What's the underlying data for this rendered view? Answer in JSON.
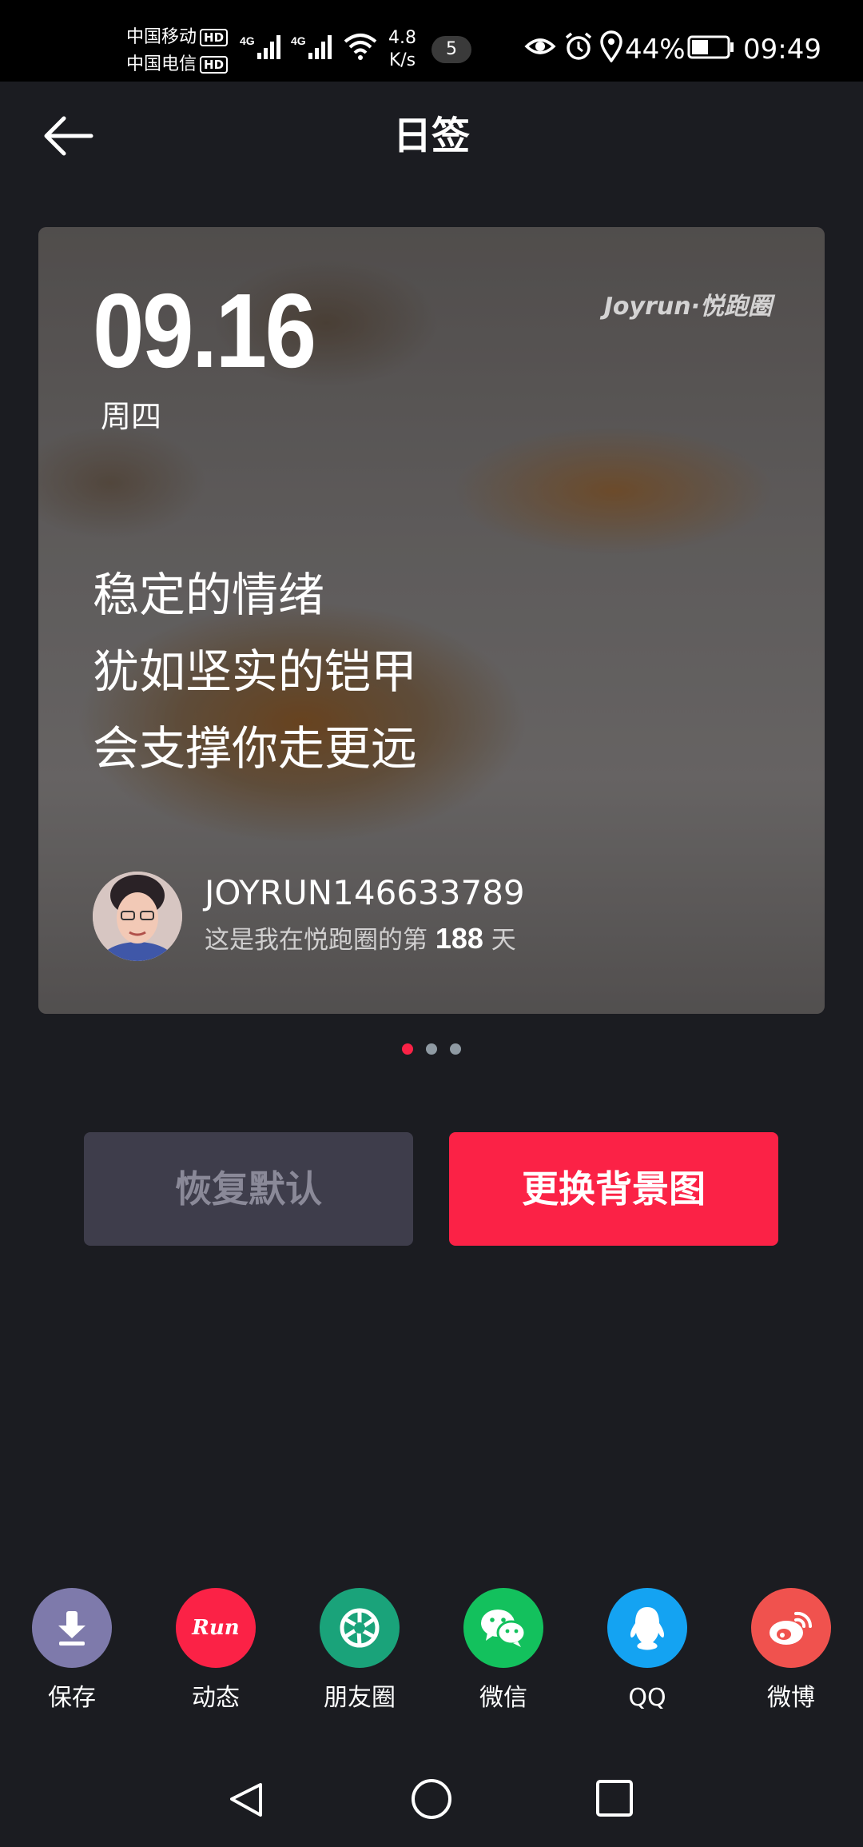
{
  "status_bar": {
    "carrier1": "中国移动",
    "carrier2": "中国电信",
    "hd": "HD",
    "net_speed_value": "4.8",
    "net_speed_unit": "K/s",
    "notification_count": "5",
    "battery": "44%",
    "time": "09:49",
    "network": "4G"
  },
  "header": {
    "title": "日签"
  },
  "card": {
    "date": "09.16",
    "weekday": "周四",
    "logo": "Joyrun·悦跑圈",
    "quote_lines": [
      "稳定的情绪",
      "犹如坚实的铠甲",
      "会支撑你走更远"
    ],
    "username": "JOYRUN146633789",
    "days_prefix": "这是我在悦跑圈的第",
    "days_count": "188",
    "days_suffix": "天"
  },
  "pager": {
    "total": 3,
    "active": 0,
    "active_color": "#fb2246",
    "inactive_color": "#8f9aa3"
  },
  "actions": {
    "reset_label": "恢复默认",
    "change_bg_label": "更换背景图"
  },
  "share": [
    {
      "label": "保存",
      "icon": "download-icon",
      "color": "#7e7aab"
    },
    {
      "label": "动态",
      "icon": "run-icon",
      "color": "#fb2246"
    },
    {
      "label": "朋友圈",
      "icon": "moments-icon",
      "color": "#1aa37a"
    },
    {
      "label": "微信",
      "icon": "wechat-icon",
      "color": "#13c15d"
    },
    {
      "label": "QQ",
      "icon": "qq-icon",
      "color": "#14a3f2"
    },
    {
      "label": "微博",
      "icon": "weibo-icon",
      "color": "#f0524e"
    }
  ],
  "run_icon_text": "Run"
}
